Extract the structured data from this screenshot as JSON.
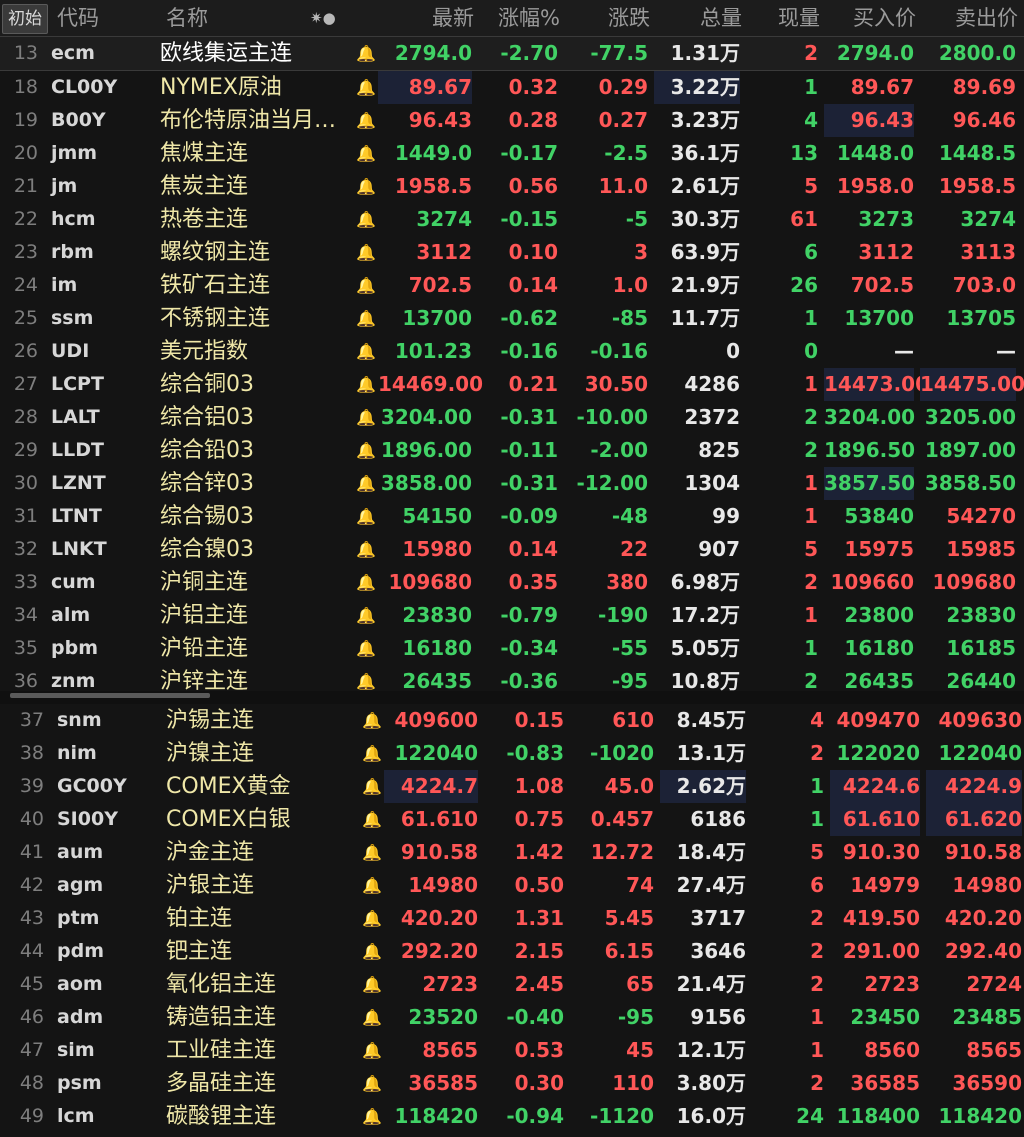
{
  "header": {
    "init_label": "初始",
    "columns": [
      "代码",
      "名称",
      "最新",
      "涨幅%",
      "涨跌",
      "总量",
      "现量",
      "买入价",
      "卖出价"
    ],
    "star_dot": "✷●"
  },
  "colors": {
    "up": "#ff5757",
    "down": "#41d266",
    "flat": "#e8e8e8",
    "name": "#efe7a8",
    "alert_active": "#ff5a1f"
  },
  "rows": [
    {
      "num": "13",
      "code": "ecm",
      "name": "欧线集运主连",
      "bell": "bell-icon",
      "last": "2794.0",
      "chg_pct": "-2.70",
      "chg": "-77.5",
      "vol": "1.31万",
      "cur": "2",
      "bid": "2794.0",
      "ask": "2800.0",
      "dir": "down",
      "cur_dir": "up",
      "bid_dir": "down",
      "ask_dir": "down"
    },
    {
      "num": "18",
      "code": "CL00Y",
      "name": "NYMEX原油",
      "bell": "bell-icon",
      "last": "89.67",
      "chg_pct": "0.32",
      "chg": "0.29",
      "vol": "3.22万",
      "cur": "1",
      "bid": "89.67",
      "ask": "89.69",
      "dir": "up",
      "cur_dir": "down",
      "bid_dir": "up",
      "ask_dir": "up"
    },
    {
      "num": "19",
      "code": "B00Y",
      "name": "布伦特原油当月…",
      "bell": "bell-icon",
      "last": "96.43",
      "chg_pct": "0.28",
      "chg": "0.27",
      "vol": "3.23万",
      "cur": "4",
      "bid": "96.43",
      "ask": "96.46",
      "dir": "up",
      "cur_dir": "down",
      "bid_dir": "up",
      "ask_dir": "up"
    },
    {
      "num": "20",
      "code": "jmm",
      "name": "焦煤主连",
      "bell": "bell-icon",
      "last": "1449.0",
      "chg_pct": "-0.17",
      "chg": "-2.5",
      "vol": "36.1万",
      "cur": "13",
      "bid": "1448.0",
      "ask": "1448.5",
      "dir": "down",
      "cur_dir": "down",
      "bid_dir": "down",
      "ask_dir": "down"
    },
    {
      "num": "21",
      "code": "jm",
      "name": "焦炭主连",
      "bell": "bell-icon",
      "last": "1958.5",
      "chg_pct": "0.56",
      "chg": "11.0",
      "vol": "2.61万",
      "cur": "5",
      "bid": "1958.0",
      "ask": "1958.5",
      "dir": "up",
      "cur_dir": "up",
      "bid_dir": "up",
      "ask_dir": "up"
    },
    {
      "num": "22",
      "code": "hcm",
      "name": "热卷主连",
      "bell": "bell-icon",
      "last": "3274",
      "chg_pct": "-0.15",
      "chg": "-5",
      "vol": "30.3万",
      "cur": "61",
      "bid": "3273",
      "ask": "3274",
      "dir": "down",
      "cur_dir": "up",
      "bid_dir": "down",
      "ask_dir": "down"
    },
    {
      "num": "23",
      "code": "rbm",
      "name": "螺纹钢主连",
      "bell": "bell-icon",
      "last": "3112",
      "chg_pct": "0.10",
      "chg": "3",
      "vol": "63.9万",
      "cur": "6",
      "bid": "3112",
      "ask": "3113",
      "dir": "up",
      "cur_dir": "down",
      "bid_dir": "up",
      "ask_dir": "up"
    },
    {
      "num": "24",
      "code": "im",
      "name": "铁矿石主连",
      "bell": "bell-icon",
      "last": "702.5",
      "chg_pct": "0.14",
      "chg": "1.0",
      "vol": "21.9万",
      "cur": "26",
      "bid": "702.5",
      "ask": "703.0",
      "dir": "up",
      "cur_dir": "down",
      "bid_dir": "up",
      "ask_dir": "up"
    },
    {
      "num": "25",
      "code": "ssm",
      "name": "不锈钢主连",
      "bell": "bell-icon",
      "last": "13700",
      "chg_pct": "-0.62",
      "chg": "-85",
      "vol": "11.7万",
      "cur": "1",
      "bid": "13700",
      "ask": "13705",
      "dir": "down",
      "cur_dir": "down",
      "bid_dir": "down",
      "ask_dir": "down"
    },
    {
      "num": "26",
      "code": "UDI",
      "name": "美元指数",
      "bell": "bell-icon",
      "last": "101.23",
      "chg_pct": "-0.16",
      "chg": "-0.16",
      "vol": "0",
      "cur": "0",
      "bid": "—",
      "ask": "—",
      "dir": "down",
      "cur_dir": "down",
      "bid_dir": "flat",
      "ask_dir": "flat"
    },
    {
      "num": "27",
      "code": "LCPT",
      "name": "综合铜03",
      "bell": "bell-icon",
      "last": "14469.00",
      "chg_pct": "0.21",
      "chg": "30.50",
      "vol": "4286",
      "cur": "1",
      "bid": "14473.00",
      "ask": "14475.00",
      "dir": "up",
      "cur_dir": "up",
      "bid_dir": "up",
      "ask_dir": "up"
    },
    {
      "num": "28",
      "code": "LALT",
      "name": "综合铝03",
      "bell": "bell-icon",
      "last": "3204.00",
      "chg_pct": "-0.31",
      "chg": "-10.00",
      "vol": "2372",
      "cur": "2",
      "bid": "3204.00",
      "ask": "3205.00",
      "dir": "down",
      "cur_dir": "down",
      "bid_dir": "down",
      "ask_dir": "down"
    },
    {
      "num": "29",
      "code": "LLDT",
      "name": "综合铅03",
      "bell": "bell-icon",
      "last": "1896.00",
      "chg_pct": "-0.11",
      "chg": "-2.00",
      "vol": "825",
      "cur": "2",
      "bid": "1896.50",
      "ask": "1897.00",
      "dir": "down",
      "cur_dir": "down",
      "bid_dir": "down",
      "ask_dir": "down"
    },
    {
      "num": "30",
      "code": "LZNT",
      "name": "综合锌03",
      "bell": "bell-icon",
      "last": "3858.00",
      "chg_pct": "-0.31",
      "chg": "-12.00",
      "vol": "1304",
      "cur": "1",
      "bid": "3857.50",
      "ask": "3858.50",
      "dir": "down",
      "cur_dir": "up",
      "bid_dir": "down",
      "ask_dir": "down"
    },
    {
      "num": "31",
      "code": "LTNT",
      "name": "综合锡03",
      "bell": "bell-icon",
      "last": "54150",
      "chg_pct": "-0.09",
      "chg": "-48",
      "vol": "99",
      "cur": "1",
      "bid": "53840",
      "ask": "54270",
      "dir": "down",
      "cur_dir": "up",
      "bid_dir": "down",
      "ask_dir": "up"
    },
    {
      "num": "32",
      "code": "LNKT",
      "name": "综合镍03",
      "bell": "bell-icon",
      "last": "15980",
      "chg_pct": "0.14",
      "chg": "22",
      "vol": "907",
      "cur": "5",
      "bid": "15975",
      "ask": "15985",
      "dir": "up",
      "cur_dir": "up",
      "bid_dir": "up",
      "ask_dir": "up"
    },
    {
      "num": "33",
      "code": "cum",
      "name": "沪铜主连",
      "bell": "bell-active-icon",
      "last": "109680",
      "chg_pct": "0.35",
      "chg": "380",
      "vol": "6.98万",
      "cur": "2",
      "bid": "109660",
      "ask": "109680",
      "dir": "up",
      "cur_dir": "up",
      "bid_dir": "up",
      "ask_dir": "up"
    },
    {
      "num": "34",
      "code": "alm",
      "name": "沪铝主连",
      "bell": "bell-icon",
      "last": "23830",
      "chg_pct": "-0.79",
      "chg": "-190",
      "vol": "17.2万",
      "cur": "1",
      "bid": "23800",
      "ask": "23830",
      "dir": "down",
      "cur_dir": "up",
      "bid_dir": "down",
      "ask_dir": "down"
    },
    {
      "num": "35",
      "code": "pbm",
      "name": "沪铅主连",
      "bell": "bell-icon",
      "last": "16180",
      "chg_pct": "-0.34",
      "chg": "-55",
      "vol": "5.05万",
      "cur": "1",
      "bid": "16180",
      "ask": "16185",
      "dir": "down",
      "cur_dir": "down",
      "bid_dir": "down",
      "ask_dir": "down"
    },
    {
      "num": "36",
      "code": "znm",
      "name": "沪锌主连",
      "bell": "bell-icon",
      "last": "26435",
      "chg_pct": "-0.36",
      "chg": "-95",
      "vol": "10.8万",
      "cur": "2",
      "bid": "26435",
      "ask": "26440",
      "dir": "down",
      "cur_dir": "down",
      "bid_dir": "down",
      "ask_dir": "down"
    },
    {
      "num": "37",
      "code": "snm",
      "name": "沪锡主连",
      "bell": "bell-icon",
      "last": "409600",
      "chg_pct": "0.15",
      "chg": "610",
      "vol": "8.45万",
      "cur": "4",
      "bid": "409470",
      "ask": "409630",
      "dir": "up",
      "cur_dir": "up",
      "bid_dir": "up",
      "ask_dir": "up"
    },
    {
      "num": "38",
      "code": "nim",
      "name": "沪镍主连",
      "bell": "bell-icon",
      "last": "122040",
      "chg_pct": "-0.83",
      "chg": "-1020",
      "vol": "13.1万",
      "cur": "2",
      "bid": "122020",
      "ask": "122040",
      "dir": "down",
      "cur_dir": "up",
      "bid_dir": "down",
      "ask_dir": "down"
    },
    {
      "num": "39",
      "code": "GC00Y",
      "name": "COMEX黄金",
      "bell": "bell-icon",
      "last": "4224.7",
      "chg_pct": "1.08",
      "chg": "45.0",
      "vol": "2.62万",
      "cur": "1",
      "bid": "4224.6",
      "ask": "4224.9",
      "dir": "up",
      "cur_dir": "down",
      "bid_dir": "up",
      "ask_dir": "up"
    },
    {
      "num": "40",
      "code": "SI00Y",
      "name": "COMEX白银",
      "bell": "bell-active-icon",
      "last": "61.610",
      "chg_pct": "0.75",
      "chg": "0.457",
      "vol": "6186",
      "cur": "1",
      "bid": "61.610",
      "ask": "61.620",
      "dir": "up",
      "cur_dir": "down",
      "bid_dir": "up",
      "ask_dir": "up"
    },
    {
      "num": "41",
      "code": "aum",
      "name": "沪金主连",
      "bell": "bell-active-icon",
      "last": "910.58",
      "chg_pct": "1.42",
      "chg": "12.72",
      "vol": "18.4万",
      "cur": "5",
      "bid": "910.30",
      "ask": "910.58",
      "dir": "up",
      "cur_dir": "up",
      "bid_dir": "up",
      "ask_dir": "up"
    },
    {
      "num": "42",
      "code": "agm",
      "name": "沪银主连",
      "bell": "bell-icon",
      "last": "14980",
      "chg_pct": "0.50",
      "chg": "74",
      "vol": "27.4万",
      "cur": "6",
      "bid": "14979",
      "ask": "14980",
      "dir": "up",
      "cur_dir": "up",
      "bid_dir": "up",
      "ask_dir": "up"
    },
    {
      "num": "43",
      "code": "ptm",
      "name": "铂主连",
      "bell": "bell-icon",
      "last": "420.20",
      "chg_pct": "1.31",
      "chg": "5.45",
      "vol": "3717",
      "cur": "2",
      "bid": "419.50",
      "ask": "420.20",
      "dir": "up",
      "cur_dir": "up",
      "bid_dir": "up",
      "ask_dir": "up"
    },
    {
      "num": "44",
      "code": "pdm",
      "name": "钯主连",
      "bell": "bell-icon",
      "last": "292.20",
      "chg_pct": "2.15",
      "chg": "6.15",
      "vol": "3646",
      "cur": "2",
      "bid": "291.00",
      "ask": "292.40",
      "dir": "up",
      "cur_dir": "up",
      "bid_dir": "up",
      "ask_dir": "up"
    },
    {
      "num": "45",
      "code": "aom",
      "name": "氧化铝主连",
      "bell": "bell-icon",
      "last": "2723",
      "chg_pct": "2.45",
      "chg": "65",
      "vol": "21.4万",
      "cur": "2",
      "bid": "2723",
      "ask": "2724",
      "dir": "up",
      "cur_dir": "up",
      "bid_dir": "up",
      "ask_dir": "up"
    },
    {
      "num": "46",
      "code": "adm",
      "name": "铸造铝主连",
      "bell": "bell-icon",
      "last": "23520",
      "chg_pct": "-0.40",
      "chg": "-95",
      "vol": "9156",
      "cur": "1",
      "bid": "23450",
      "ask": "23485",
      "dir": "down",
      "cur_dir": "up",
      "bid_dir": "down",
      "ask_dir": "down"
    },
    {
      "num": "47",
      "code": "sim",
      "name": "工业硅主连",
      "bell": "bell-icon",
      "last": "8565",
      "chg_pct": "0.53",
      "chg": "45",
      "vol": "12.1万",
      "cur": "1",
      "bid": "8560",
      "ask": "8565",
      "dir": "up",
      "cur_dir": "up",
      "bid_dir": "up",
      "ask_dir": "up"
    },
    {
      "num": "48",
      "code": "psm",
      "name": "多晶硅主连",
      "bell": "bell-icon",
      "last": "36585",
      "chg_pct": "0.30",
      "chg": "110",
      "vol": "3.80万",
      "cur": "2",
      "bid": "36585",
      "ask": "36590",
      "dir": "up",
      "cur_dir": "up",
      "bid_dir": "up",
      "ask_dir": "up"
    },
    {
      "num": "49",
      "code": "lcm",
      "name": "碳酸锂主连",
      "bell": "bell-icon",
      "last": "118420",
      "chg_pct": "-0.94",
      "chg": "-1120",
      "vol": "16.0万",
      "cur": "24",
      "bid": "118400",
      "ask": "118420",
      "dir": "down",
      "cur_dir": "down",
      "bid_dir": "down",
      "ask_dir": "down"
    }
  ]
}
